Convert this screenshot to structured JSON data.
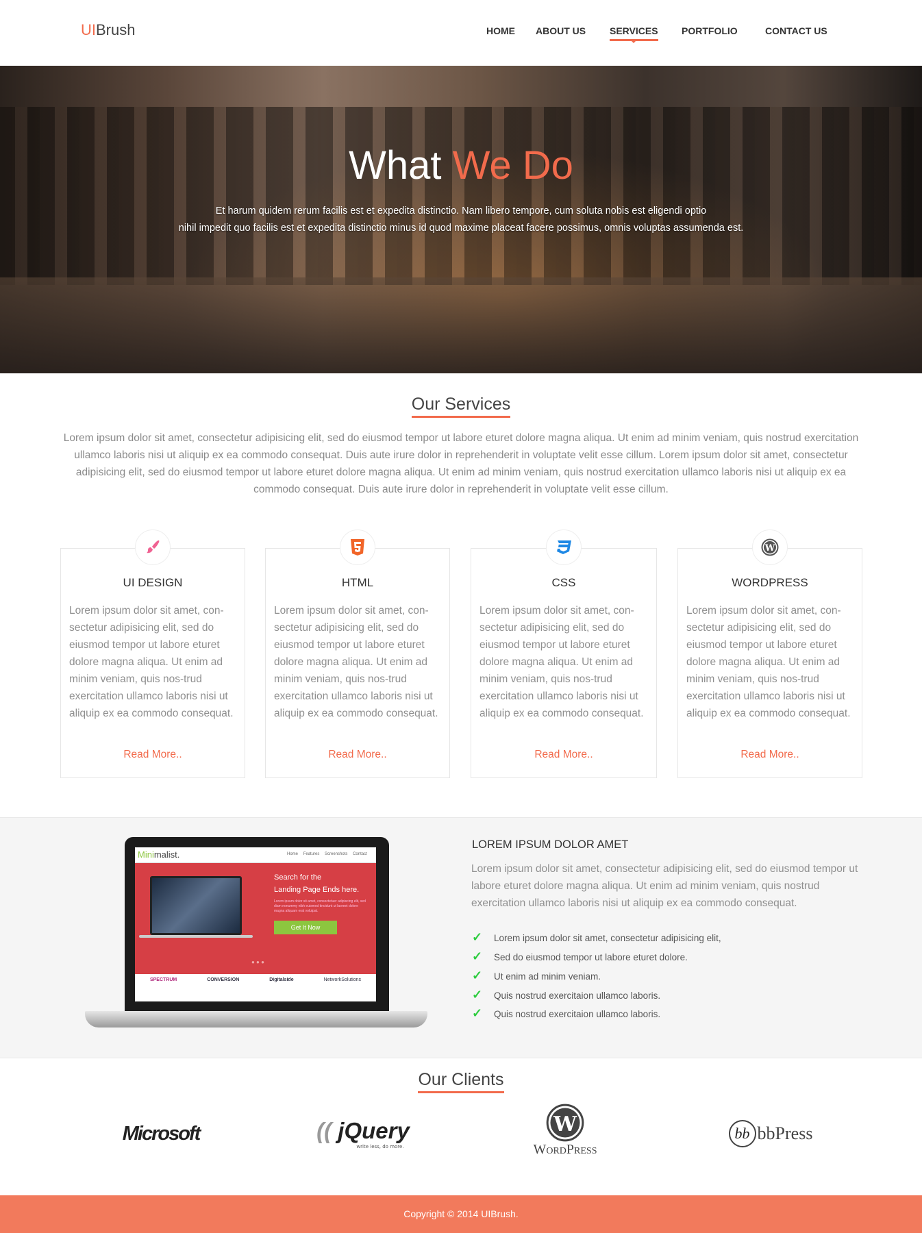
{
  "brand": {
    "prefix": "UI",
    "suffix": "Brush"
  },
  "nav": {
    "items": [
      "HOME",
      "ABOUT US",
      "SERVICES",
      "PORTFOLIO",
      "CONTACT US"
    ],
    "active": "SERVICES"
  },
  "hero": {
    "title_white": "What",
    "title_accent": "We Do",
    "lines": [
      "Et harum quidem rerum facilis est et expedita distinctio. Nam libero tempore, cum soluta nobis est eligendi optio",
      "nihil impedit quo facilis est et expedita distinctio minus id quod maxime placeat facere possimus, omnis voluptas assumenda est."
    ]
  },
  "services": {
    "title": "Our Services",
    "intro": "Lorem ipsum dolor sit amet, consectetur adipisicing elit, sed do eiusmod tempor ut labore eturet dolore magna aliqua. Ut enim ad minim veniam, quis nostrud exercitation ullamco laboris nisi ut aliquip ex ea commodo consequat. Duis aute irure dolor in reprehenderit in voluptate velit esse cillum.  Lorem ipsum dolor sit amet, consectetur adipisicing elit, sed do eiusmod tempor  ut labore eturet dolore magna aliqua. Ut enim ad minim veniam, quis nostrud exercitation ullamco laboris nisi ut aliquip ex ea commodo consequat. Duis aute irure dolor in reprehenderit in voluptate velit esse cillum.",
    "cards": [
      {
        "icon": "paintbrush-icon",
        "title": "UI DESIGN",
        "text": "Lorem ipsum dolor sit amet, con-sectetur adipisicing elit, sed do eiusmod tempor  ut labore eturet dolore magna aliqua. Ut enim ad minim veniam, quis nos-trud exercitation ullamco laboris nisi ut aliquip ex ea commodo consequat.",
        "link": "Read More.."
      },
      {
        "icon": "html5-icon",
        "title": "HTML",
        "text": "Lorem ipsum dolor sit amet, con-sectetur adipisicing elit, sed do eiusmod tempor  ut labore eturet dolore magna aliqua. Ut enim ad minim veniam, quis nos-trud exercitation ullamco laboris nisi ut aliquip ex ea commodo consequat.",
        "link": "Read More.."
      },
      {
        "icon": "css3-icon",
        "title": "CSS",
        "text": "Lorem ipsum dolor sit amet, con-sectetur adipisicing elit, sed do eiusmod tempor  ut labore eturet dolore magna aliqua. Ut enim ad minim veniam, quis nos-trud exercitation ullamco laboris nisi ut aliquip ex ea commodo consequat.",
        "link": "Read More.."
      },
      {
        "icon": "wordpress-icon",
        "title": "WORDPRESS",
        "text": "Lorem ipsum dolor sit amet, con-sectetur adipisicing elit, sed do eiusmod tempor  ut labore eturet dolore magna aliqua. Ut enim ad minim veniam, quis nos-trud exercitation ullamco laboris nisi ut aliquip ex ea commodo consequat.",
        "link": "Read More.."
      }
    ]
  },
  "mockup": {
    "brand_a": "Mini",
    "brand_b": "malist.",
    "menu": [
      "Home",
      "Features",
      "Screenshots",
      "Contact"
    ],
    "headline1": "Search for the",
    "headline2": "Landing Page Ends here.",
    "body": "Lorem ipsum dolor sit amet, consectetuer adipiscing elit, sed diam nonummy nibh euismod tincidunt ut laoreet dolore magna aliquam erat volutpat.",
    "cta": "Get It Now",
    "logos": [
      "SPECTRUM",
      "CONVERSION",
      "Digitalside",
      "NetworkSolutions"
    ]
  },
  "feature": {
    "title": "LOREM IPSUM DOLOR AMET",
    "para": "Lorem ipsum dolor sit amet, consectetur adipisicing elit, sed do eiusmod tempor  ut labore eturet dolore magna aliqua. Ut enim ad minim veniam, quis nostrud exercitation ullamco laboris nisi ut aliquip ex ea commodo consequat.",
    "list": [
      "Lorem ipsum dolor sit amet, consectetur adipisicing elit,",
      "Sed do eiusmod tempor ut labore eturet dolore.",
      "Ut enim ad minim veniam.",
      "Quis nostrud exercitaion ullamco laboris.",
      "Quis nostrud exercitaion ullamco laboris."
    ],
    "tick": "✓"
  },
  "clients": {
    "title": "Our Clients",
    "logos": [
      "Microsoft",
      "jQuery",
      "write less, do more.",
      "WordPress",
      "bbPress"
    ]
  },
  "footer": {
    "text": "Copyright © 2014 UIBrush."
  },
  "colors": {
    "accent": "#f26b4c",
    "footer": "#f27a5c",
    "check": "#2ecc40"
  }
}
